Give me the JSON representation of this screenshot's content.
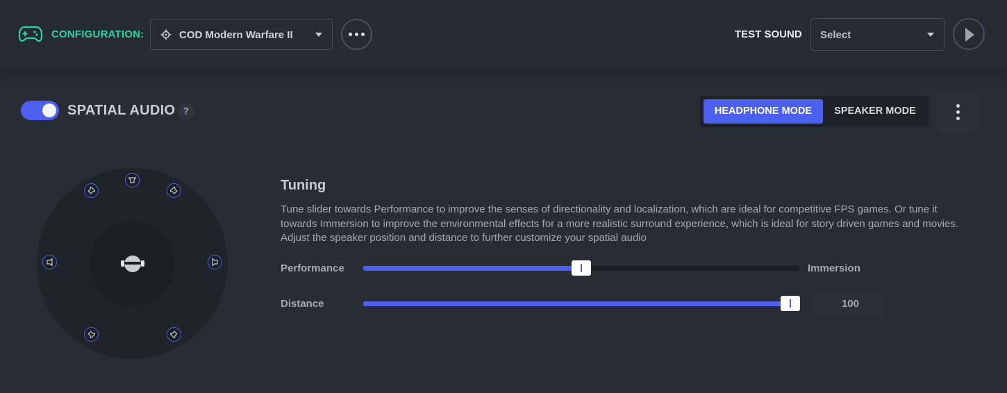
{
  "topbar": {
    "config_label": "CONFIGURATION:",
    "config_value": "COD Modern Warfare II",
    "config_icon": "game-target-icon",
    "more_icon": "more-horizontal-icon",
    "test_sound_label": "TEST SOUND",
    "test_sound_value": "Select",
    "play_icon": "play-icon"
  },
  "spatial_audio": {
    "enabled": true,
    "title": "SPATIAL AUDIO",
    "help": "?",
    "modes": [
      {
        "label": "HEADPHONE MODE",
        "active": true
      },
      {
        "label": "SPEAKER MODE",
        "active": false
      }
    ],
    "kebab_icon": "more-vertical-icon"
  },
  "speakers": [
    "front-left",
    "center",
    "front-right",
    "side-left",
    "side-right",
    "rear-left",
    "rear-right"
  ],
  "tuning": {
    "title": "Tuning",
    "description": "Tune slider towards Performance to improve the senses of directionality and localization, which are ideal for competitive FPS games. Or tune it towards Immersion to improve the environmental effects for a more realistic surround experience, which is ideal for story driven games and movies. Adjust the speaker position and distance to further customize your spatial audio",
    "performance_label": "Performance",
    "immersion_label": "Immersion",
    "performance_level_percent": 50,
    "distance_label": "Distance",
    "distance_level_percent": 98,
    "distance_value": "100"
  },
  "colors": {
    "accent": "#4d5ff0",
    "config_green": "#2ad4a8",
    "background": "#252a33"
  }
}
